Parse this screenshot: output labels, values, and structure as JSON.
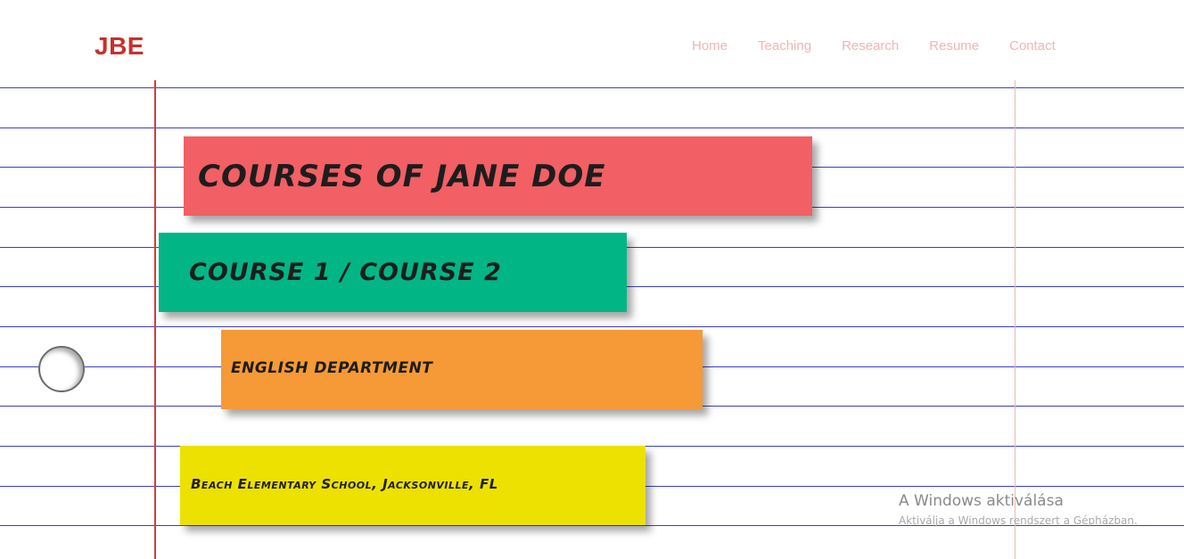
{
  "header": {
    "logo": "JBE",
    "nav": [
      {
        "label": "Home"
      },
      {
        "label": "Teaching"
      },
      {
        "label": "Research"
      },
      {
        "label": "Resume"
      },
      {
        "label": "Contact"
      }
    ]
  },
  "main": {
    "title": "Courses of Jane Doe",
    "courses": "Course 1 / Course 2",
    "department": "English Department",
    "school": "Beach Elementary School, Jacksonville, FL"
  },
  "watermark": {
    "title": "A Windows aktiválása",
    "subtitle": "Aktiválja a Windows rendszert a Gépházban."
  },
  "colors": {
    "logo": "#c9302c",
    "nav": "#f3b4b4",
    "rule_lines": "#3a3fc4",
    "margin_line": "#d23b3b",
    "note_title": "#f25f65",
    "note_courses": "#02b585",
    "note_department": "#f59a36",
    "note_school": "#ece100"
  }
}
